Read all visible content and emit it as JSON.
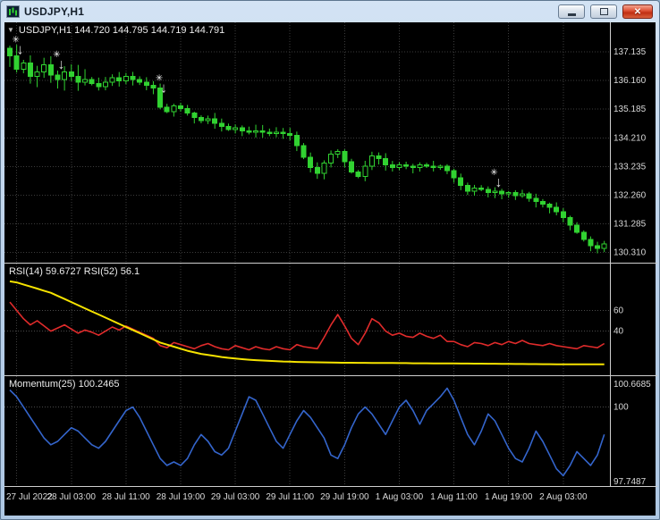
{
  "window": {
    "title": "USDJPY,H1",
    "buttons": {
      "close_glyph": "✕"
    }
  },
  "chart": {
    "symbol_line": "USDJPY,H1 144.720 144.795 144.719 144.791",
    "dropdown_glyph": "▼",
    "price_axis": [
      "137.135",
      "136.160",
      "135.185",
      "134.210",
      "133.235",
      "132.260",
      "131.285",
      "130.310"
    ],
    "time_axis": [
      "27 Jul 2022",
      "28 Jul 03:00",
      "28 Jul 11:00",
      "28 Jul 19:00",
      "29 Jul 03:00",
      "29 Jul 11:00",
      "29 Jul 19:00",
      "1 Aug 03:00",
      "1 Aug 11:00",
      "1 Aug 19:00",
      "2 Aug 03:00"
    ]
  },
  "rsi": {
    "label": "RSI(14) 59.6727  RSI(52) 56.1",
    "axis": [
      "60",
      "40"
    ]
  },
  "momentum": {
    "label": "Momentum(25) 100.2465",
    "axis": [
      "100.6685",
      "100",
      "97.7487"
    ]
  },
  "colors": {
    "candle": "#31d231",
    "bull_fill": "#000000",
    "rsi": "#e02b2b",
    "rsi_signal": "#f6e300",
    "momentum": "#3465cc",
    "grid": "#3c3c3c",
    "level": "#4a4a4a",
    "axis_text": "#d9d9d9",
    "separator": "#cfcfcf",
    "marker": "#d8d8d8"
  },
  "chart_data": {
    "type": "candlestick",
    "symbol": "USDJPY",
    "timeframe": "H1",
    "price_ticks": [
      137.135,
      136.16,
      135.185,
      134.21,
      133.235,
      132.26,
      131.285,
      130.31
    ],
    "closes": [
      137.0,
      136.55,
      136.75,
      136.3,
      136.45,
      136.7,
      136.35,
      136.2,
      136.45,
      136.3,
      136.1,
      136.2,
      136.05,
      135.95,
      136.1,
      136.25,
      136.15,
      136.3,
      136.2,
      136.1,
      136.0,
      135.9,
      135.25,
      135.1,
      135.3,
      135.2,
      135.05,
      134.9,
      134.8,
      134.85,
      134.7,
      134.6,
      134.5,
      134.55,
      134.45,
      134.4,
      134.45,
      134.4,
      134.35,
      134.4,
      134.35,
      134.3,
      133.95,
      133.55,
      133.2,
      133.0,
      133.35,
      133.65,
      133.75,
      133.4,
      133.05,
      132.9,
      133.25,
      133.6,
      133.5,
      133.3,
      133.2,
      133.3,
      133.25,
      133.2,
      133.3,
      133.25,
      133.2,
      133.25,
      133.1,
      132.85,
      132.6,
      132.4,
      132.5,
      132.45,
      132.35,
      132.4,
      132.3,
      132.35,
      132.25,
      132.3,
      132.15,
      132.05,
      131.95,
      131.85,
      131.7,
      131.5,
      131.25,
      131.0,
      130.75,
      130.55,
      130.45,
      130.6
    ],
    "indicators": [
      {
        "name": "RSI",
        "panel": "rsi",
        "levels": [
          60,
          40
        ],
        "series": [
          {
            "name": "RSI(14)",
            "color_key": "rsi",
            "values": [
              68,
              60,
              52,
              46,
              50,
              45,
              40,
              43,
              46,
              42,
              38,
              41,
              39,
              36,
              40,
              44,
              41,
              45,
              42,
              39,
              36,
              33,
              26,
              24,
              29,
              27,
              25,
              23,
              26,
              28,
              25,
              23,
              22,
              26,
              24,
              22,
              25,
              23,
              22,
              25,
              23,
              22,
              27,
              25,
              24,
              23,
              34,
              46,
              56,
              45,
              33,
              27,
              38,
              52,
              48,
              40,
              36,
              38,
              35,
              34,
              38,
              35,
              33,
              36,
              30,
              30,
              27,
              25,
              29,
              28,
              26,
              29,
              27,
              30,
              28,
              31,
              28,
              27,
              26,
              28,
              26,
              25,
              24,
              23,
              26,
              25,
              24,
              28
            ]
          },
          {
            "name": "RSI(52)",
            "color_key": "rsi_signal",
            "values": [
              88,
              87,
              85,
              83,
              81,
              79,
              77,
              74,
              71,
              68,
              65,
              62,
              59,
              56,
              53,
              50,
              47,
              44,
              41,
              38,
              35,
              32,
              29,
              27,
              25,
              23,
              21,
              19.5,
              18,
              17,
              16,
              15,
              14.2,
              13.5,
              12.9,
              12.4,
              12,
              11.6,
              11.3,
              11,
              10.7,
              10.5,
              10.3,
              10.1,
              10,
              9.9,
              9.8,
              9.7,
              9.6,
              9.5,
              9.5,
              9.4,
              9.4,
              9.3,
              9.3,
              9.2,
              9.2,
              9.1,
              9.1,
              9,
              9,
              9,
              8.9,
              8.9,
              8.8,
              8.8,
              8.7,
              8.7,
              8.6,
              8.6,
              8.5,
              8.5,
              8.4,
              8.4,
              8.3,
              8.3,
              8.2,
              8.2,
              8.1,
              8.1,
              8,
              8,
              8,
              8,
              8,
              8,
              8,
              8
            ]
          }
        ]
      },
      {
        "name": "Momentum",
        "panel": "momentum",
        "ticks": [
          100.6685,
          100,
          97.7487
        ],
        "series": [
          {
            "name": "Momentum(25)",
            "color_key": "momentum",
            "values": [
              100.5,
              100.3,
              100.0,
              99.7,
              99.4,
              99.1,
              98.9,
              99.0,
              99.2,
              99.4,
              99.3,
              99.1,
              98.9,
              98.8,
              99.0,
              99.3,
              99.6,
              99.9,
              100.0,
              99.7,
              99.3,
              98.9,
              98.5,
              98.3,
              98.4,
              98.3,
              98.5,
              98.9,
              99.2,
              99.0,
              98.7,
              98.6,
              98.8,
              99.3,
              99.8,
              100.3,
              100.2,
              99.8,
              99.4,
              99.0,
              98.8,
              99.2,
              99.6,
              99.9,
              99.7,
              99.4,
              99.1,
              98.6,
              98.5,
              98.9,
              99.4,
              99.8,
              100.0,
              99.8,
              99.5,
              99.2,
              99.6,
              100.0,
              100.2,
              99.9,
              99.5,
              99.9,
              100.1,
              100.3,
              100.55,
              100.2,
              99.7,
              99.2,
              98.9,
              99.3,
              99.8,
              99.6,
              99.2,
              98.8,
              98.5,
              98.4,
              98.8,
              99.3,
              99.0,
              98.6,
              98.2,
              98.0,
              98.3,
              98.7,
              98.5,
              98.3,
              98.6,
              99.2
            ]
          }
        ]
      }
    ],
    "markers": [
      {
        "bar": 1,
        "price": 137.45
      },
      {
        "bar": 7,
        "price": 136.95
      },
      {
        "bar": 22,
        "price": 136.15
      },
      {
        "bar": 71,
        "price": 132.95
      }
    ]
  }
}
